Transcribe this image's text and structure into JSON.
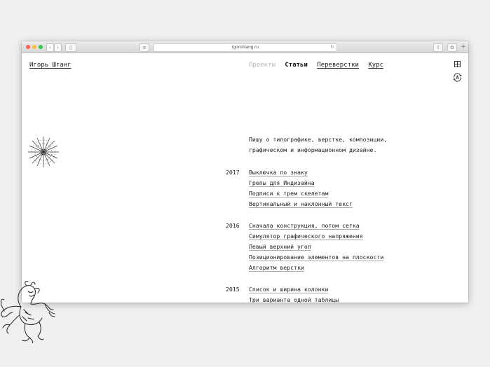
{
  "browser": {
    "url": "igorshtang.ru",
    "colors": {
      "close": "#fc605b",
      "minimize": "#fdbc40",
      "zoom": "#34c84a"
    }
  },
  "site": {
    "brand": "Игорь Штанг",
    "nav": [
      {
        "label": "Проекты",
        "state": "inactive"
      },
      {
        "label": "Статьи",
        "state": "active"
      },
      {
        "label": "Переверстки",
        "state": "link"
      },
      {
        "label": "Курс",
        "state": "link"
      }
    ],
    "icons": [
      "grid-icon",
      "language-switch-icon"
    ],
    "intro": "Пишу о типографике, верстке, композиции, графическом и информационном дизайне."
  },
  "articles": [
    {
      "year": "2017",
      "items": [
        "Выключка по знаку",
        "Грепы для Индизайна",
        "Подписи к трем скелетам",
        "Вертикальный и наклонный текст"
      ]
    },
    {
      "year": "2016",
      "items": [
        "Сначала конструкция, потом сетка",
        "Симулятор графического напряжения",
        "Левый верхний угол",
        "Позиционирование элементов на плоскости",
        "Алгоритм верстки"
      ]
    },
    {
      "year": "2015",
      "items": [
        "Список и ширина колонки",
        "Три варианта одной таблицы"
      ]
    }
  ]
}
